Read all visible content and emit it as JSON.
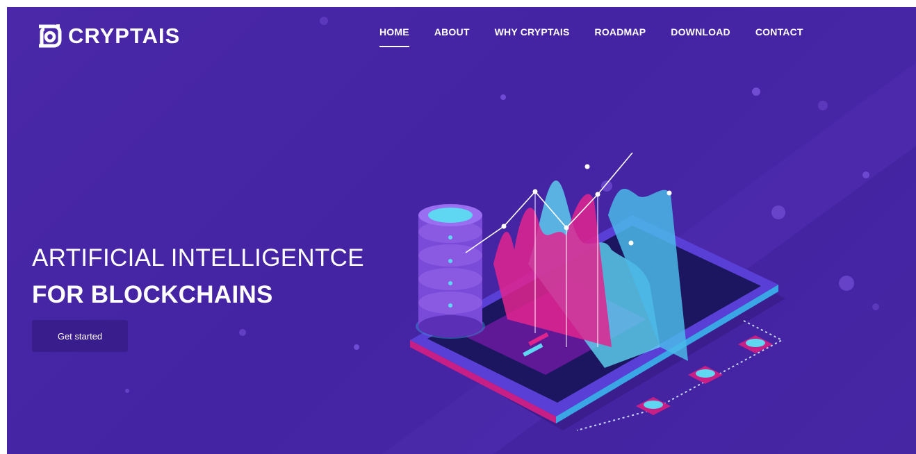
{
  "brand": {
    "name": "CRYPTAIS",
    "logo_icon": "cryptais-logo-icon"
  },
  "nav": {
    "items": [
      {
        "label": "HOME",
        "active": true
      },
      {
        "label": "ABOUT",
        "active": false
      },
      {
        "label": "WHY CRYPTAIS",
        "active": false
      },
      {
        "label": "ROADMAP",
        "active": false
      },
      {
        "label": "DOWNLOAD",
        "active": false
      },
      {
        "label": "CONTACT",
        "active": false
      }
    ]
  },
  "hero": {
    "headline_line1": "ARTIFICIAL INTELLIGENTCE",
    "headline_line2": "FOR BLOCKCHAINS",
    "cta_label": "Get started",
    "illustration": "isometric-blockchain-analytics-illustration"
  },
  "colors": {
    "background": "#4a28a8",
    "button": "#3a1d8c",
    "text": "#ffffff",
    "accent_pink": "#e0248e",
    "accent_cyan": "#5fd6f2"
  }
}
